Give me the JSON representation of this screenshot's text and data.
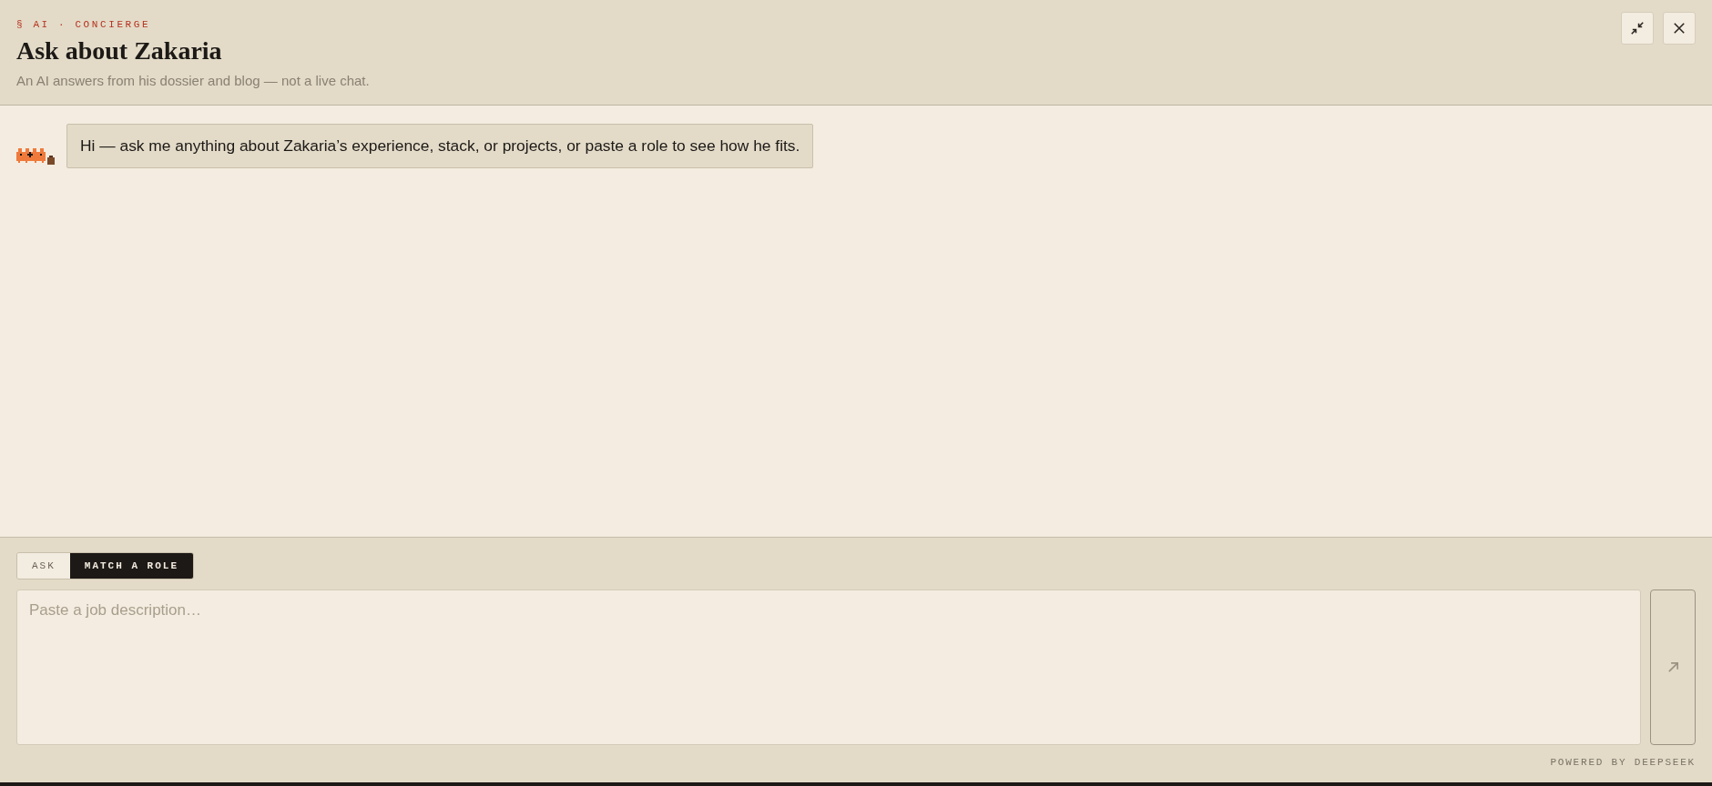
{
  "header": {
    "eyebrow": "§ AI · CONCIERGE",
    "title": "Ask about Zakaria",
    "subtitle": "An AI answers from his dossier and blog — not a live chat.",
    "controls": [
      {
        "kind": "collapse"
      },
      {
        "kind": "close"
      }
    ]
  },
  "messages": [
    {
      "kind": "assistant",
      "text": "Hi — ask me anything about Zakaria’s experience, stack, or projects, or paste a role to see how he fits."
    }
  ],
  "composer": {
    "tabs": [
      {
        "label": "ASK",
        "selected": false
      },
      {
        "label": "MATCH A ROLE",
        "selected": true
      }
    ],
    "input": {
      "placeholder": "Paste a job description…"
    },
    "send_button": {
      "disabled": true
    }
  },
  "footer": {
    "powered_by": "POWERED BY DEEPSEEK"
  }
}
